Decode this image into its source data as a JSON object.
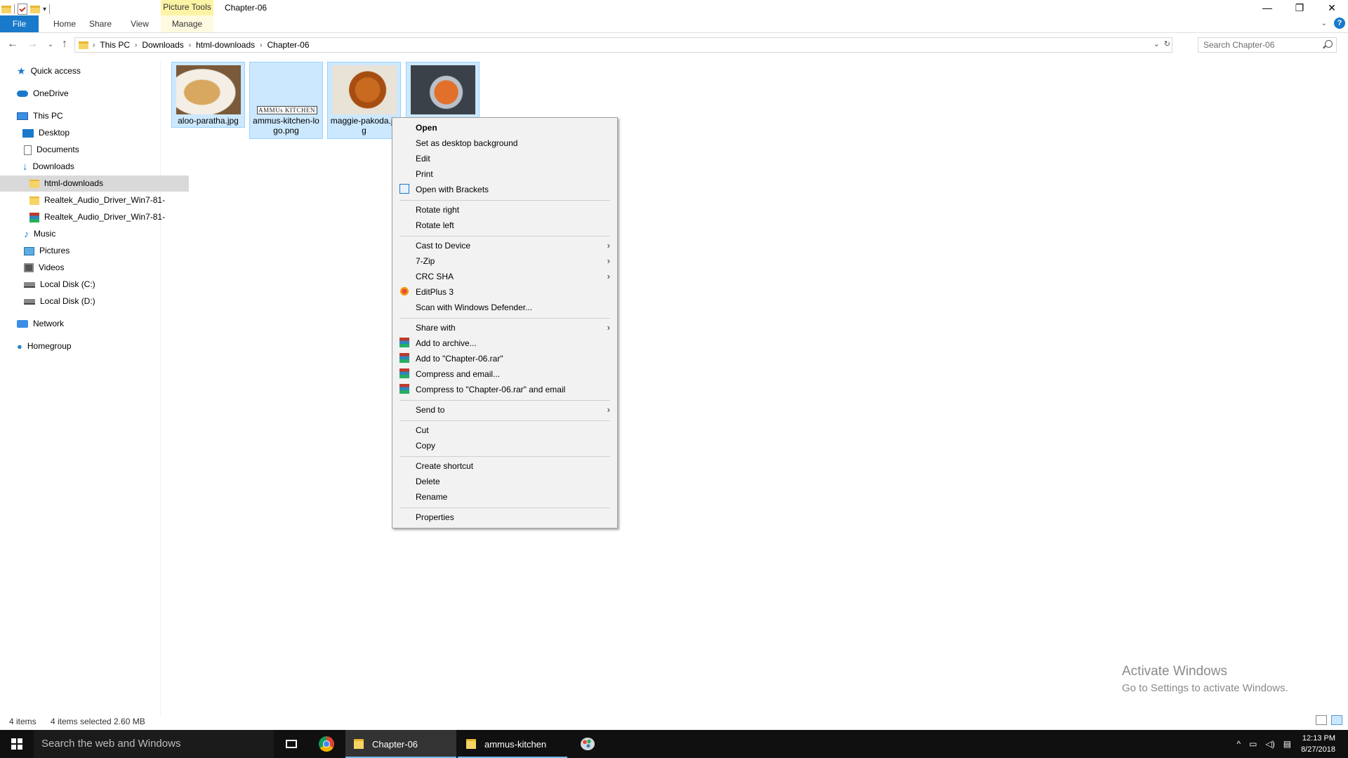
{
  "window": {
    "context_tab": "Picture Tools",
    "title": "Chapter-06"
  },
  "ribbon": {
    "tabs": [
      {
        "label": "File"
      },
      {
        "label": "Home"
      },
      {
        "label": "Share"
      },
      {
        "label": "View"
      },
      {
        "label": "Manage"
      }
    ],
    "help_label": "?"
  },
  "address": {
    "crumbs": [
      "This PC",
      "Downloads",
      "html-downloads",
      "Chapter-06"
    ]
  },
  "search": {
    "placeholder": "Search Chapter-06"
  },
  "sidebar": {
    "items": [
      {
        "label": "Quick access",
        "icon": "star-icon"
      },
      {
        "label": "OneDrive",
        "icon": "cloud-icon"
      },
      {
        "label": "This PC",
        "icon": "computer-icon"
      },
      {
        "label": "Desktop",
        "icon": "desktop-icon"
      },
      {
        "label": "Documents",
        "icon": "document-icon"
      },
      {
        "label": "Downloads",
        "icon": "download-arrow-icon"
      },
      {
        "label": "html-downloads",
        "icon": "folder-icon",
        "selected": true
      },
      {
        "label": "Realtek_Audio_Driver_Win7-81-",
        "icon": "folder-icon"
      },
      {
        "label": "Realtek_Audio_Driver_Win7-81-",
        "icon": "rar-archive-icon"
      },
      {
        "label": "Music",
        "icon": "music-note-icon"
      },
      {
        "label": "Pictures",
        "icon": "pictures-icon"
      },
      {
        "label": "Videos",
        "icon": "video-icon"
      },
      {
        "label": "Local Disk (C:)",
        "icon": "disk-icon"
      },
      {
        "label": "Local Disk (D:)",
        "icon": "disk-icon"
      },
      {
        "label": "Network",
        "icon": "network-icon"
      },
      {
        "label": "Homegroup",
        "icon": "homegroup-icon"
      }
    ]
  },
  "files": [
    {
      "name": "aloo-paratha.jpg",
      "thumbnail": "food-photo"
    },
    {
      "name": "ammus-kitchen-logo.png",
      "thumbnail": "logo",
      "logo_text": "AMMUs KITCHEN"
    },
    {
      "name": "maggie-pakoda.jpg",
      "thumbnail": "food-photo"
    },
    {
      "name": "",
      "thumbnail": "food-photo"
    }
  ],
  "context_menu": {
    "open": "Open",
    "set_desktop_bg": "Set as desktop background",
    "edit": "Edit",
    "print": "Print",
    "open_with_brackets": "Open with Brackets",
    "rotate_right": "Rotate right",
    "rotate_left": "Rotate left",
    "cast_to_device": "Cast to Device",
    "seven_zip": "7-Zip",
    "crc_sha": "CRC SHA",
    "editplus": "EditPlus 3",
    "scan_defender": "Scan with Windows Defender...",
    "share_with": "Share with",
    "add_to_archive": "Add to archive...",
    "add_to_rar": "Add to \"Chapter-06.rar\"",
    "compress_email": "Compress and email...",
    "compress_rar_email": "Compress to \"Chapter-06.rar\" and email",
    "send_to": "Send to",
    "cut": "Cut",
    "copy": "Copy",
    "create_shortcut": "Create shortcut",
    "delete": "Delete",
    "rename": "Rename",
    "properties": "Properties"
  },
  "status": {
    "item_count": "4 items",
    "selection": "4 items selected  2.60 MB"
  },
  "watermark": {
    "line1": "Activate Windows",
    "line2": "Go to Settings to activate Windows."
  },
  "taskbar": {
    "search_placeholder": "Search the web and Windows",
    "windows": [
      {
        "label": "Chapter-06",
        "active": true
      },
      {
        "label": "ammus-kitchen",
        "active": false
      }
    ],
    "time": "12:13 PM",
    "date": "8/27/2018"
  },
  "colors": {
    "accent": "#1979ca",
    "selection_bg": "#cce8ff",
    "selection_border": "#99d1ff",
    "picture_tools": "#fdf3a5",
    "taskbar": "#101010"
  }
}
